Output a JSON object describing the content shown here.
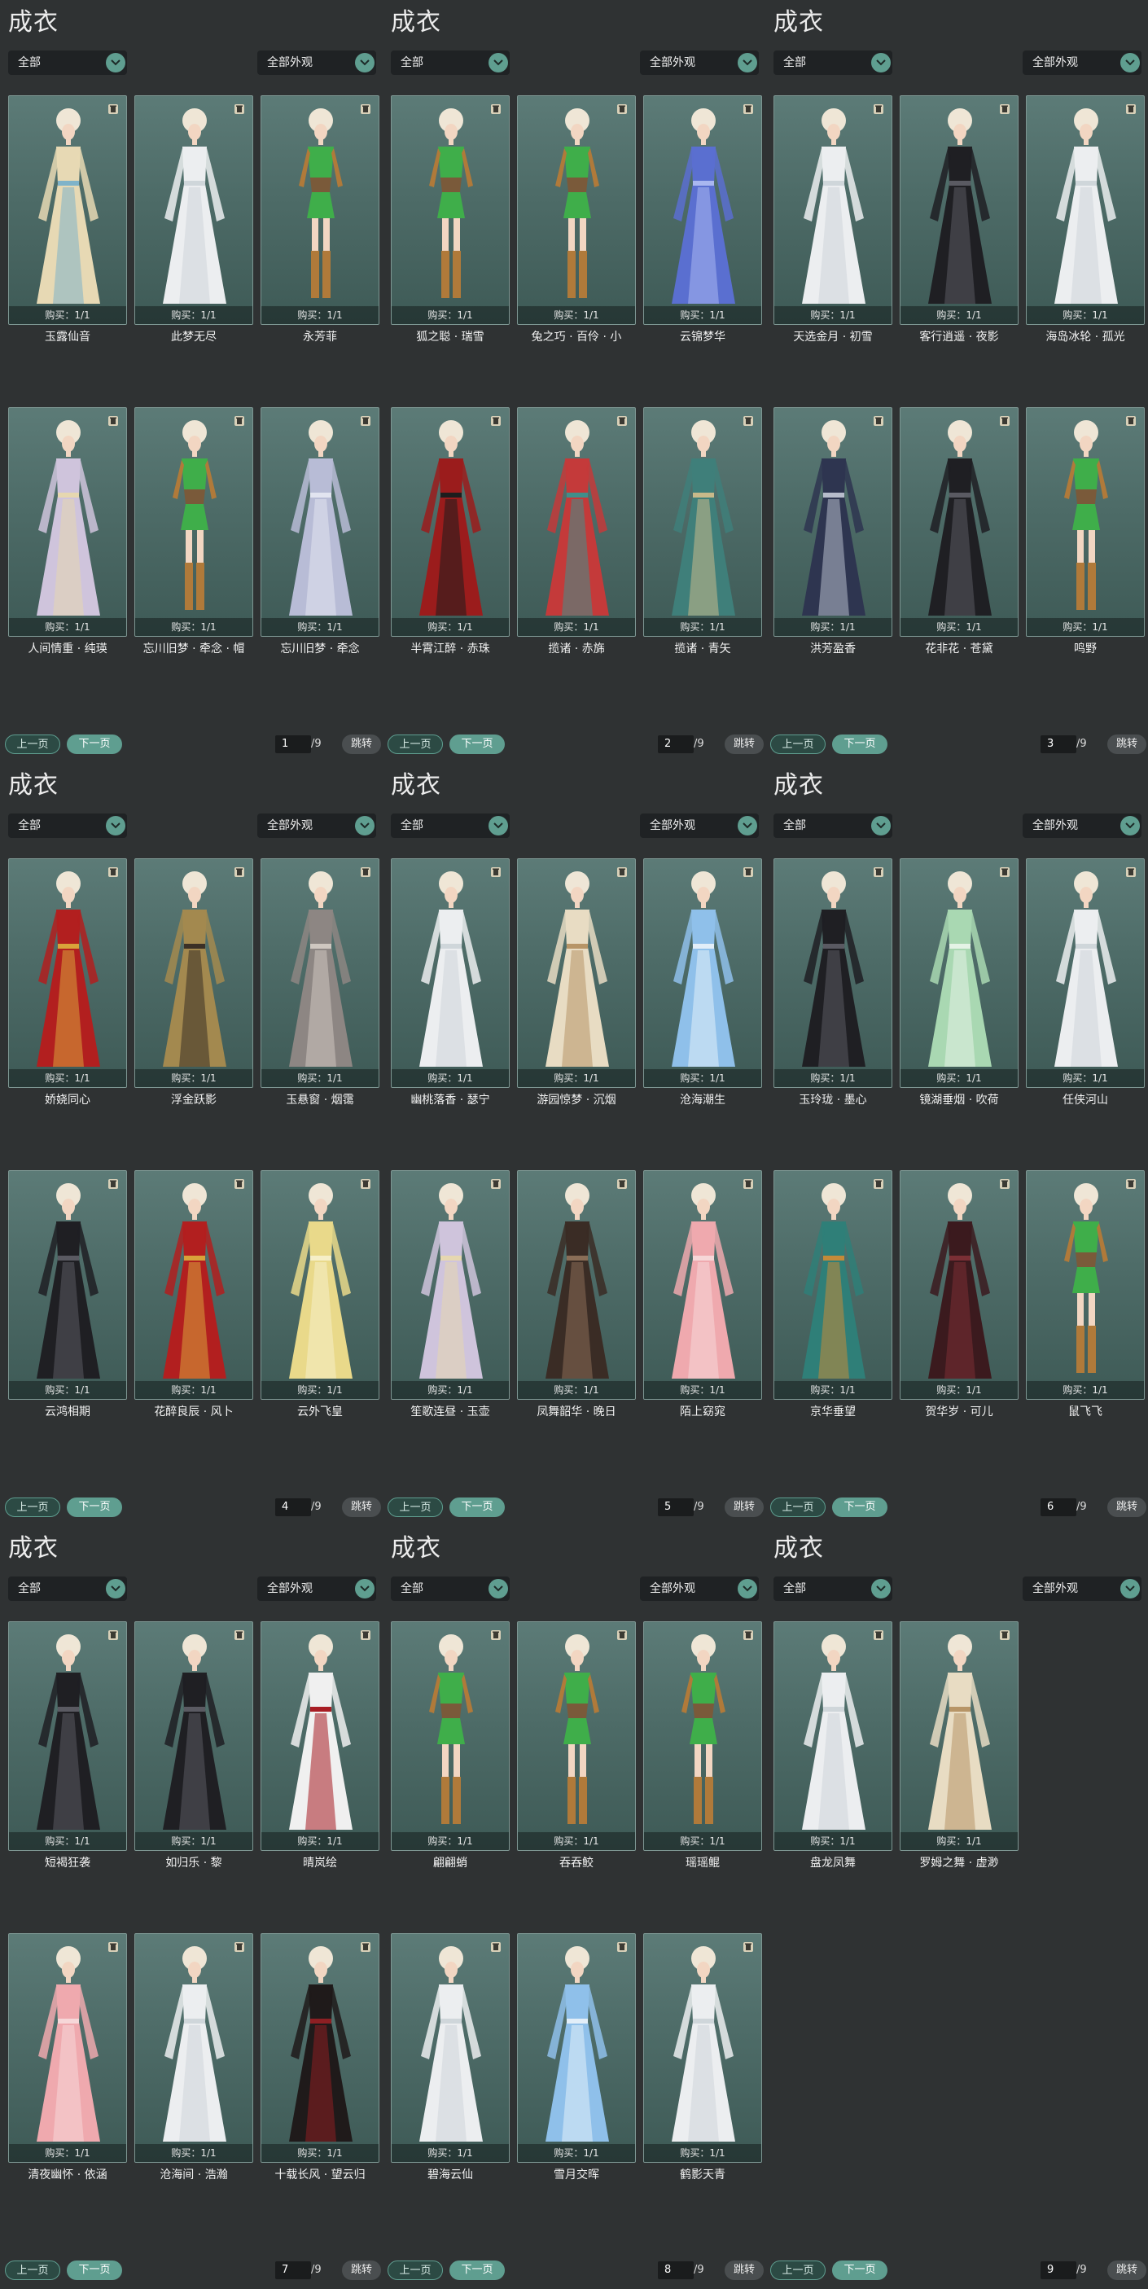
{
  "labels": {
    "title": "成衣",
    "filter_left": "全部",
    "filter_right": "全部外观",
    "prev": "上一页",
    "next": "下一页",
    "jump": "跳转",
    "total_suffix": "/9",
    "buy_prefix": "购买：",
    "buy_value": "1/1"
  },
  "colors": {
    "accent": "#5f9e90",
    "background": "#2f3233",
    "card_bg": "#4d6b67"
  },
  "icons": {
    "trash": "trash-icon",
    "caret": "chevron-down-icon"
  },
  "panels": [
    {
      "page": "1",
      "items": [
        {
          "name": "玉露仙音",
          "outfit": "gold-flowing"
        },
        {
          "name": "此梦无尽",
          "outfit": "white-gown"
        },
        {
          "name": "永芳菲",
          "outfit": "green-default"
        },
        {
          "name": "人间情重 · 纯瑛",
          "outfit": "lilac-gown"
        },
        {
          "name": "忘川旧梦 · 牵念 · 帽",
          "outfit": "green-default"
        },
        {
          "name": "忘川旧梦 · 牵念",
          "outfit": "silver-gown"
        }
      ]
    },
    {
      "page": "2",
      "items": [
        {
          "name": "狐之聪 · 瑞雪",
          "outfit": "green-default"
        },
        {
          "name": "兔之巧 · 百伶 · 小",
          "outfit": "green-default"
        },
        {
          "name": "云锦梦华",
          "outfit": "blue-gown"
        },
        {
          "name": "半霄江醉 · 赤珠",
          "outfit": "red-black"
        },
        {
          "name": "揽诸 · 赤旆",
          "outfit": "red-teal"
        },
        {
          "name": "揽诸 · 青矢",
          "outfit": "teal-gown"
        }
      ]
    },
    {
      "page": "3",
      "items": [
        {
          "name": "天选金月 · 初雪",
          "outfit": "white-gown"
        },
        {
          "name": "客行逍遥 · 夜影",
          "outfit": "black-gown"
        },
        {
          "name": "海岛冰轮 · 孤光",
          "outfit": "white-gown"
        },
        {
          "name": "洪芳盈香",
          "outfit": "navy-gown"
        },
        {
          "name": "花非花 · 苍黛",
          "outfit": "black-gown"
        },
        {
          "name": "鸣野",
          "outfit": "green-default"
        }
      ]
    },
    {
      "page": "4",
      "items": [
        {
          "name": "娇娆同心",
          "outfit": "red-gown"
        },
        {
          "name": "浮金跃影",
          "outfit": "gold-gown"
        },
        {
          "name": "玉悬窗 · 烟霭",
          "outfit": "grey-gown"
        },
        {
          "name": "云鸿相期",
          "outfit": "black-gown"
        },
        {
          "name": "花醉良辰 · 风卜",
          "outfit": "red-gown"
        },
        {
          "name": "云外飞皇",
          "outfit": "yellow-gown"
        }
      ]
    },
    {
      "page": "5",
      "items": [
        {
          "name": "幽桃落香 · 瑟宁",
          "outfit": "white-gown"
        },
        {
          "name": "游园惊梦 · 沉烟",
          "outfit": "cream-gown"
        },
        {
          "name": "沧海潮生",
          "outfit": "skyblue-gown"
        },
        {
          "name": "笙歌连昼 · 玉壶",
          "outfit": "lilac-gown"
        },
        {
          "name": "凤舞韶华 · 晚日",
          "outfit": "brown-gown"
        },
        {
          "name": "陌上窈窕",
          "outfit": "pink-gown"
        }
      ]
    },
    {
      "page": "6",
      "items": [
        {
          "name": "玉玲珑 · 墨心",
          "outfit": "black-gown"
        },
        {
          "name": "镜湖垂烟 · 吹荷",
          "outfit": "mint-gown"
        },
        {
          "name": "任侠河山",
          "outfit": "white-gown"
        },
        {
          "name": "京华垂望",
          "outfit": "teal-gold"
        },
        {
          "name": "贺华岁 · 可儿",
          "outfit": "maroon-gown"
        },
        {
          "name": "鼠飞飞",
          "outfit": "green-default"
        }
      ]
    },
    {
      "page": "7",
      "items": [
        {
          "name": "短褐狂袭",
          "outfit": "black-gown"
        },
        {
          "name": "如归乐 · 黎",
          "outfit": "black-gown"
        },
        {
          "name": "晴岚绘",
          "outfit": "white-red"
        },
        {
          "name": "清夜幽怀 · 依涵",
          "outfit": "pink-gown"
        },
        {
          "name": "沧海间 · 浩瀚",
          "outfit": "white-gown"
        },
        {
          "name": "十载长风 · 望云归",
          "outfit": "black-red"
        }
      ]
    },
    {
      "page": "8",
      "items": [
        {
          "name": "翩翩蛸",
          "outfit": "green-default"
        },
        {
          "name": "吞吞鲛",
          "outfit": "green-default"
        },
        {
          "name": "瑶瑶鲲",
          "outfit": "green-default"
        },
        {
          "name": "碧海云仙",
          "outfit": "white-gown"
        },
        {
          "name": "雪月交晖",
          "outfit": "skyblue-gown"
        },
        {
          "name": "鹤影天青",
          "outfit": "white-gown"
        }
      ]
    },
    {
      "page": "9",
      "items": [
        {
          "name": "盘龙凤舞",
          "outfit": "white-gown"
        },
        {
          "name": "罗姆之舞 · 虚渺",
          "outfit": "cream-gown"
        }
      ]
    }
  ]
}
